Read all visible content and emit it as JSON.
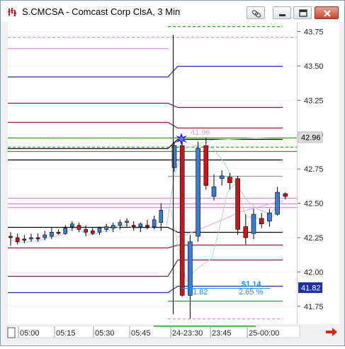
{
  "window": {
    "title": "S.CMCSA - Comcast Corp ClsA, 3 Min"
  },
  "toolbar": {
    "link_icon": "link-icon",
    "minimize_icon": "minimize-icon",
    "restore_icon": "restore-icon",
    "close_icon": "close-icon"
  },
  "chart": {
    "price_axis": [
      "43.75",
      "43.50",
      "43.25",
      "43.00",
      "42.75",
      "42.50",
      "42.25",
      "42.00",
      "41.75"
    ],
    "time_axis": [
      "05:00",
      "05:15",
      "05:30",
      "05:45",
      "24-23:30",
      "23:45",
      "25-00:00"
    ],
    "last_price_tag": "42.96",
    "low_price_tag": "41.82",
    "ghost_label": "41.96",
    "measure": {
      "amount": "$1.14",
      "price": "41.82",
      "percent": "2.65 %"
    },
    "colors": {
      "up_candle": "#3a7bd5",
      "down_candle": "#c8161d",
      "pivot_blue": "#1f2fa8",
      "pivot_maroon": "#7a1a5a",
      "pivot_red": "#a0162a",
      "green_band": "#1ea81e",
      "pink_band": "#e08ad8",
      "measure_text": "#1f8fe0"
    }
  },
  "chart_data": {
    "type": "candlestick",
    "ylim": [
      41.62,
      43.82
    ],
    "price_ticks": [
      43.75,
      43.5,
      43.25,
      43.0,
      42.75,
      42.5,
      42.25,
      42.0,
      41.75
    ],
    "session_one_candles": [
      {
        "o": 42.26,
        "h": 42.29,
        "l": 42.19,
        "c": 42.25
      },
      {
        "o": 42.25,
        "h": 42.28,
        "l": 42.2,
        "c": 42.22
      },
      {
        "o": 42.24,
        "h": 42.27,
        "l": 42.21,
        "c": 42.23
      },
      {
        "o": 42.24,
        "h": 42.28,
        "l": 42.22,
        "c": 42.25
      },
      {
        "o": 42.25,
        "h": 42.28,
        "l": 42.22,
        "c": 42.24
      },
      {
        "o": 42.25,
        "h": 42.3,
        "l": 42.23,
        "c": 42.27
      },
      {
        "o": 42.26,
        "h": 42.32,
        "l": 42.24,
        "c": 42.29
      },
      {
        "o": 42.29,
        "h": 42.31,
        "l": 42.27,
        "c": 42.28
      },
      {
        "o": 42.28,
        "h": 42.34,
        "l": 42.27,
        "c": 42.32
      },
      {
        "o": 42.33,
        "h": 42.37,
        "l": 42.3,
        "c": 42.35
      },
      {
        "o": 42.34,
        "h": 42.36,
        "l": 42.29,
        "c": 42.31
      },
      {
        "o": 42.31,
        "h": 42.34,
        "l": 42.26,
        "c": 42.29
      },
      {
        "o": 42.3,
        "h": 42.32,
        "l": 42.27,
        "c": 42.28
      },
      {
        "o": 42.29,
        "h": 42.33,
        "l": 42.27,
        "c": 42.32
      },
      {
        "o": 42.31,
        "h": 42.35,
        "l": 42.29,
        "c": 42.33
      },
      {
        "o": 42.32,
        "h": 42.36,
        "l": 42.29,
        "c": 42.34
      },
      {
        "o": 42.34,
        "h": 42.38,
        "l": 42.31,
        "c": 42.36
      },
      {
        "o": 42.36,
        "h": 42.39,
        "l": 42.33,
        "c": 42.37
      },
      {
        "o": 42.34,
        "h": 42.37,
        "l": 42.3,
        "c": 42.33
      },
      {
        "o": 42.33,
        "h": 42.36,
        "l": 42.29,
        "c": 42.35
      },
      {
        "o": 42.34,
        "h": 42.38,
        "l": 42.31,
        "c": 42.33
      },
      {
        "o": 42.33,
        "h": 42.41,
        "l": 42.31,
        "c": 42.38
      },
      {
        "o": 42.36,
        "h": 42.5,
        "l": 42.3,
        "c": 42.45
      }
    ],
    "session_two_candles": [
      {
        "o": 42.76,
        "h": 42.95,
        "l": 42.73,
        "c": 42.92
      },
      {
        "o": 42.92,
        "h": 42.96,
        "l": 41.82,
        "c": 41.83
      },
      {
        "o": 41.83,
        "h": 42.27,
        "l": 41.66,
        "c": 42.22
      },
      {
        "o": 42.26,
        "h": 42.95,
        "l": 42.22,
        "c": 42.9
      },
      {
        "o": 42.92,
        "h": 42.98,
        "l": 42.6,
        "c": 42.63
      },
      {
        "o": 42.55,
        "h": 42.71,
        "l": 42.52,
        "c": 42.62
      },
      {
        "o": 42.68,
        "h": 42.74,
        "l": 42.63,
        "c": 42.7
      },
      {
        "o": 42.69,
        "h": 42.72,
        "l": 42.6,
        "c": 42.65
      },
      {
        "o": 42.68,
        "h": 42.7,
        "l": 42.27,
        "c": 42.31
      },
      {
        "o": 42.33,
        "h": 42.42,
        "l": 42.2,
        "c": 42.25
      },
      {
        "o": 42.28,
        "h": 42.46,
        "l": 42.24,
        "c": 42.42
      },
      {
        "o": 42.39,
        "h": 42.43,
        "l": 42.32,
        "c": 42.35
      },
      {
        "o": 42.37,
        "h": 42.46,
        "l": 42.33,
        "c": 42.43
      },
      {
        "o": 42.42,
        "h": 42.62,
        "l": 42.41,
        "c": 42.58
      },
      {
        "o": 42.57,
        "h": 42.58,
        "l": 42.53,
        "c": 42.55
      }
    ],
    "levels": [
      {
        "price": 43.79,
        "color": "#1ea81e",
        "style": "dash",
        "from": "session_two"
      },
      {
        "price": 43.71,
        "color": "#e08ad8",
        "style": "dash",
        "from": "all"
      },
      {
        "price": 43.63,
        "color": "#e08ad8",
        "style": "solid",
        "from": "session_one"
      },
      {
        "price": 43.42,
        "color": "#1f2fa8",
        "style": "solid",
        "step_to": 43.5
      },
      {
        "price": 43.23,
        "color": "#7a1a5a",
        "style": "solid",
        "step_to": 43.2
      },
      {
        "price": 43.09,
        "color": "#a0162a",
        "style": "solid",
        "step_to": 43.05
      },
      {
        "price": 42.9,
        "color": "#000000",
        "style": "solid",
        "step_to": 42.97
      },
      {
        "price": 42.98,
        "color": "#1ea81e",
        "style": "solid",
        "from": "all"
      },
      {
        "price": 42.91,
        "color": "#1ea81e",
        "style": "dash",
        "from": "all"
      },
      {
        "price": 42.88,
        "color": "#1ea81e",
        "style": "solid",
        "from": "all"
      },
      {
        "price": 42.82,
        "color": "#000000",
        "style": "solid",
        "step_to": 42.82
      },
      {
        "price": 42.7,
        "color": "#9a9a9a",
        "style": "solid",
        "from": "session_two"
      },
      {
        "price": 42.54,
        "color": "#e08ad8",
        "style": "solid",
        "from": "all"
      },
      {
        "price": 42.5,
        "color": "#e08ad8",
        "style": "solid",
        "from": "all"
      },
      {
        "price": 42.47,
        "color": "#e08ad8",
        "style": "solid",
        "from": "all"
      },
      {
        "price": 42.33,
        "color": "#000000",
        "style": "solid",
        "step_to": 42.29
      },
      {
        "price": 42.18,
        "color": "#a0162a",
        "style": "solid",
        "step_to": 42.2
      },
      {
        "price": 41.97,
        "color": "#7a1a5a",
        "style": "solid",
        "step_to": 42.09
      },
      {
        "price": 41.85,
        "color": "#1f2fa8",
        "style": "solid",
        "step_to": 41.9
      },
      {
        "price": 41.79,
        "color": "#1ea81e",
        "style": "solid",
        "from": "session_two"
      },
      {
        "price": 41.66,
        "color": "#e08ad8",
        "style": "dash",
        "from": "session_two"
      },
      {
        "price": 41.61,
        "color": "#1ea81e",
        "style": "dash",
        "from": "session_two"
      }
    ]
  }
}
